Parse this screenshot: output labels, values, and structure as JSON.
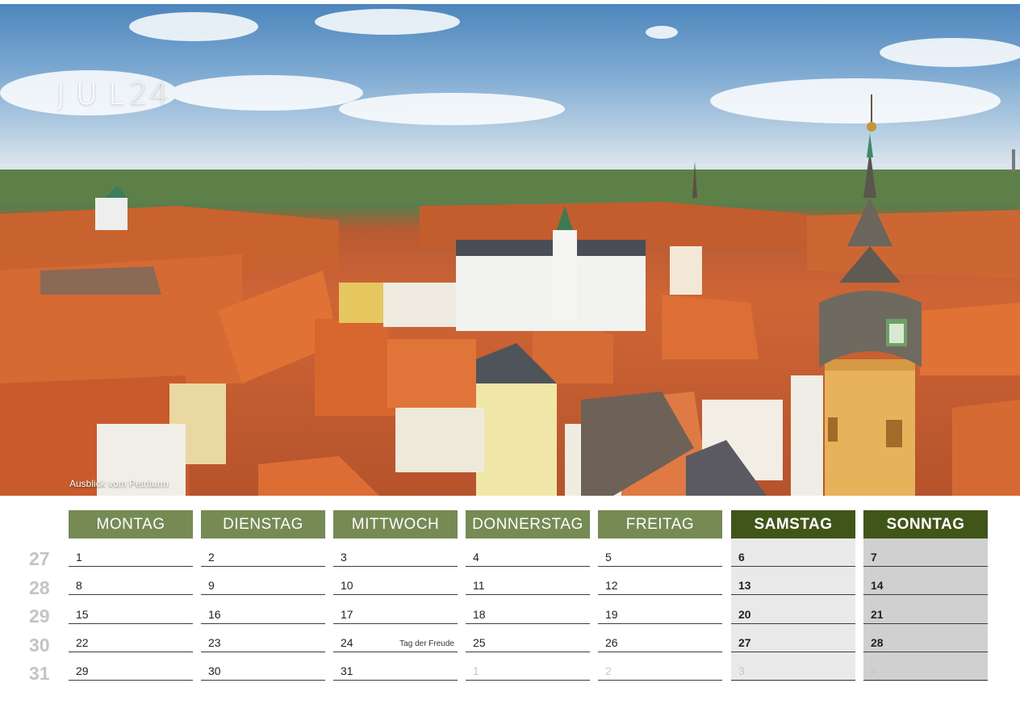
{
  "header": {
    "month": "JUL",
    "year": "24"
  },
  "photo": {
    "caption": "Ausblick vom Petriturm"
  },
  "calendar": {
    "days": [
      "MONTAG",
      "DIENSTAG",
      "MITTWOCH",
      "DONNERSTAG",
      "FREITAG",
      "SAMSTAG",
      "SONNTAG"
    ],
    "weeks": [
      "27",
      "28",
      "29",
      "30",
      "31"
    ],
    "rows": [
      [
        "1",
        "2",
        "3",
        "4",
        "5",
        "6",
        "7"
      ],
      [
        "8",
        "9",
        "10",
        "11",
        "12",
        "13",
        "14"
      ],
      [
        "15",
        "16",
        "17",
        "18",
        "19",
        "20",
        "21"
      ],
      [
        "22",
        "23",
        "24",
        "25",
        "26",
        "27",
        "28"
      ],
      [
        "29",
        "30",
        "31",
        "1",
        "2",
        "3",
        "4"
      ]
    ],
    "note": {
      "text": "Tag der Freude"
    }
  },
  "colors": {
    "weekday_header": "#758b53",
    "weekend_header": "#3f5618",
    "saturday_fill": "#e9e9e9",
    "sunday_fill": "#d0d0d0"
  }
}
